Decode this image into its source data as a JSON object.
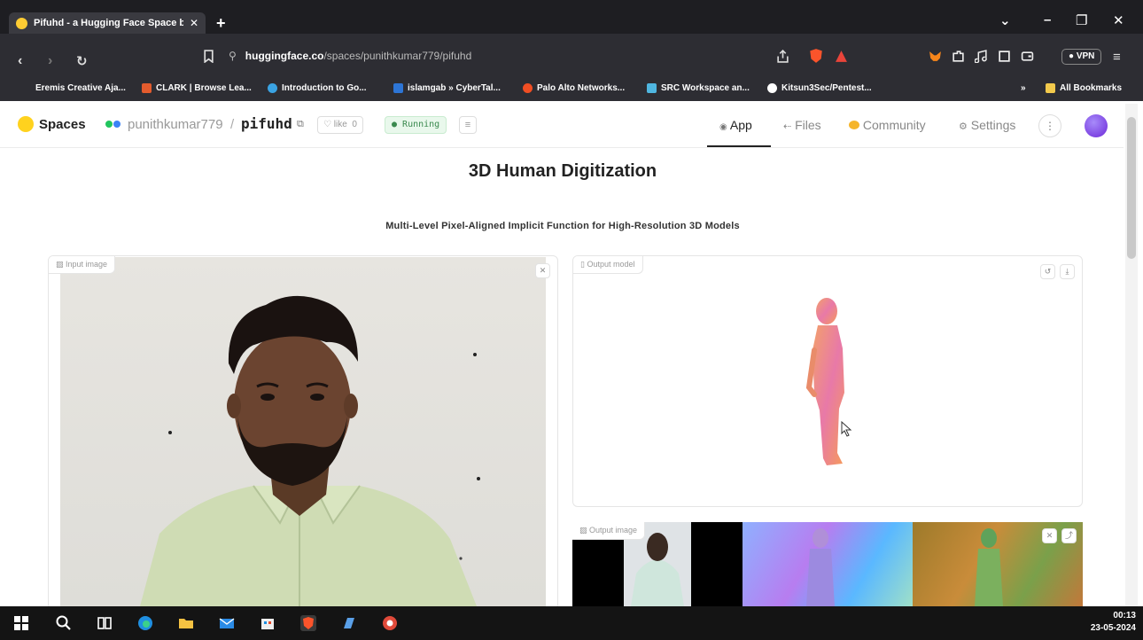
{
  "browser": {
    "tab_title": "Pifuhd - a Hugging Face Space b",
    "url_host": "huggingface.co",
    "url_path": "/spaces/punithkumar779/pifuhd",
    "vpn_label": "VPN",
    "bookmarks": [
      "Eremis Creative Aja...",
      "CLARK | Browse Lea...",
      "Introduction to Go...",
      "islamgab » CyberTal...",
      "Palo Alto Networks...",
      "SRC Workspace an...",
      "Kitsun3Sec/Pentest..."
    ],
    "all_bookmarks": "All Bookmarks"
  },
  "space_header": {
    "spaces_label": "Spaces",
    "user": "punithkumar779",
    "separator": "/",
    "repo": "pifuhd",
    "like_label": "like",
    "like_count": "0",
    "status": "Running",
    "nav": {
      "app": "App",
      "files": "Files",
      "community": "Community",
      "settings": "Settings"
    }
  },
  "app": {
    "title": "3D Human Digitization",
    "subtitle": "Multi-Level Pixel-Aligned Implicit Function for High-Resolution 3D Models",
    "input_label": "Input image",
    "output_model_label": "Output model",
    "output_image_label": "Output image"
  },
  "taskbar": {
    "time": "00:13",
    "date": "23-05-2024"
  },
  "colors": {
    "browser_chrome": "#2d2d33",
    "running_badge": "#3b8a4f",
    "avatar": "#7c3aed"
  }
}
